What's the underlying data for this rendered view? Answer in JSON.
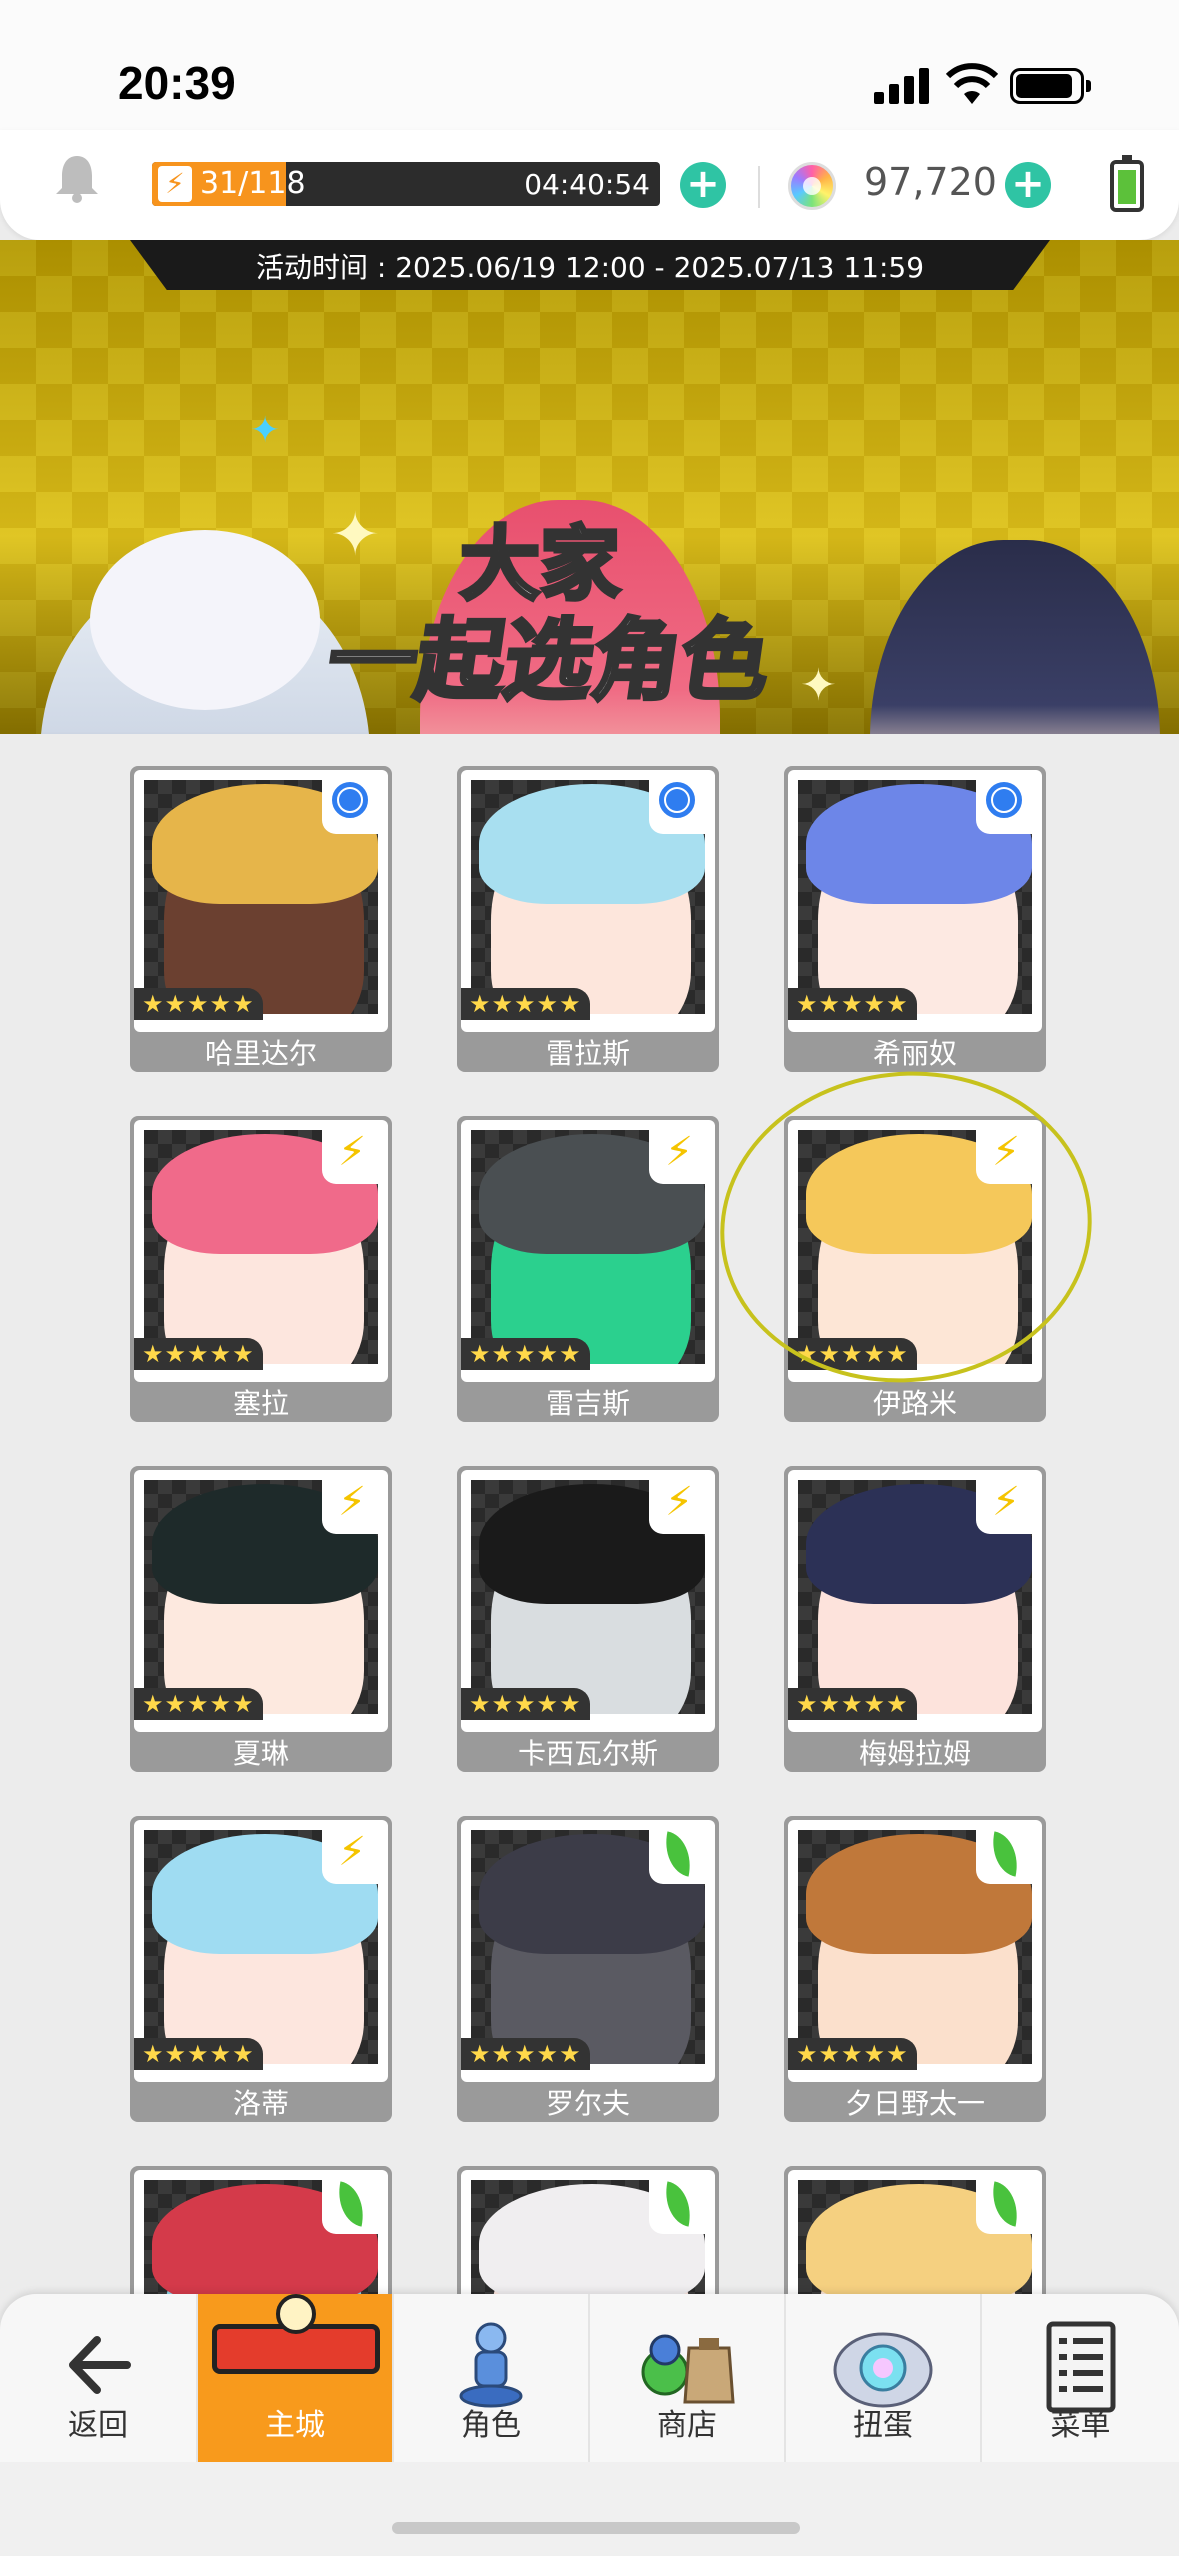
{
  "status_bar": {
    "time": "20:39"
  },
  "resources": {
    "energy_current": "31",
    "energy_max": "118",
    "energy_text": "31/118",
    "energy_timer": "04:40:54",
    "energy_fraction": 0.263,
    "gems": "97,720"
  },
  "banner": {
    "event_time": "活动时间 : 2025.06/19 12:00 - 2025.07/13 11:59",
    "title_line1": "大家",
    "title_line2": "一起选角色"
  },
  "characters": [
    {
      "name": "哈里达尔",
      "stars": "★★★★★",
      "badge": "ring-icon",
      "hair": "#e6b54a",
      "face": "#6b4030"
    },
    {
      "name": "雷拉斯",
      "stars": "★★★★★",
      "badge": "ring-icon",
      "hair": "#a8dff0",
      "face": "#fde6dc"
    },
    {
      "name": "希丽奴",
      "stars": "★★★★★",
      "badge": "ring-icon",
      "hair": "#6d86e8",
      "face": "#fde9e2"
    },
    {
      "name": "塞拉",
      "stars": "★★★★★",
      "badge": "bolt-icon",
      "hair": "#f06a8a",
      "face": "#fde6de"
    },
    {
      "name": "雷吉斯",
      "stars": "★★★★★",
      "badge": "bolt-icon",
      "hair": "#4a4f52",
      "face": "#2bd08e"
    },
    {
      "name": "伊路米",
      "stars": "★★★★★",
      "badge": "bolt-icon",
      "hair": "#f5c85a",
      "face": "#fde6d6"
    },
    {
      "name": "夏琳",
      "stars": "★★★★★",
      "badge": "bolt-icon",
      "hair": "#1e2a2a",
      "face": "#fde9df"
    },
    {
      "name": "卡西瓦尔斯",
      "stars": "★★★★★",
      "badge": "bolt-icon",
      "hair": "#1a1a1a",
      "face": "#d9dde0"
    },
    {
      "name": "梅姆拉姆",
      "stars": "★★★★★",
      "badge": "bolt-icon",
      "hair": "#2c3156",
      "face": "#fde3dc"
    },
    {
      "name": "洛蒂",
      "stars": "★★★★★",
      "badge": "bolt-icon",
      "hair": "#9fdcf2",
      "face": "#fde6de"
    },
    {
      "name": "罗尔夫",
      "stars": "★★★★★",
      "badge": "leaf-icon",
      "hair": "#3c3c48",
      "face": "#5a5a62"
    },
    {
      "name": "夕日野太一",
      "stars": "★★★★★",
      "badge": "leaf-icon",
      "hair": "#c0783a",
      "face": "#fbe0cc"
    },
    {
      "name": "",
      "stars": "",
      "badge": "leaf-icon",
      "hair": "#d43a4a",
      "face": "#8ed6e8"
    },
    {
      "name": "",
      "stars": "",
      "badge": "leaf-icon",
      "hair": "#f0eef0",
      "face": "#fde9e2"
    },
    {
      "name": "",
      "stars": "",
      "badge": "leaf-icon",
      "hair": "#f5d080",
      "face": "#fde6d6"
    }
  ],
  "nav": {
    "back": "返回",
    "home": "主城",
    "characters": "角色",
    "shop": "商店",
    "gacha": "扭蛋",
    "menu": "菜单"
  },
  "colors": {
    "accent_orange": "#f89a1c",
    "plus_green": "#2fc4a4",
    "annotation_circle": "#c7c21d"
  }
}
